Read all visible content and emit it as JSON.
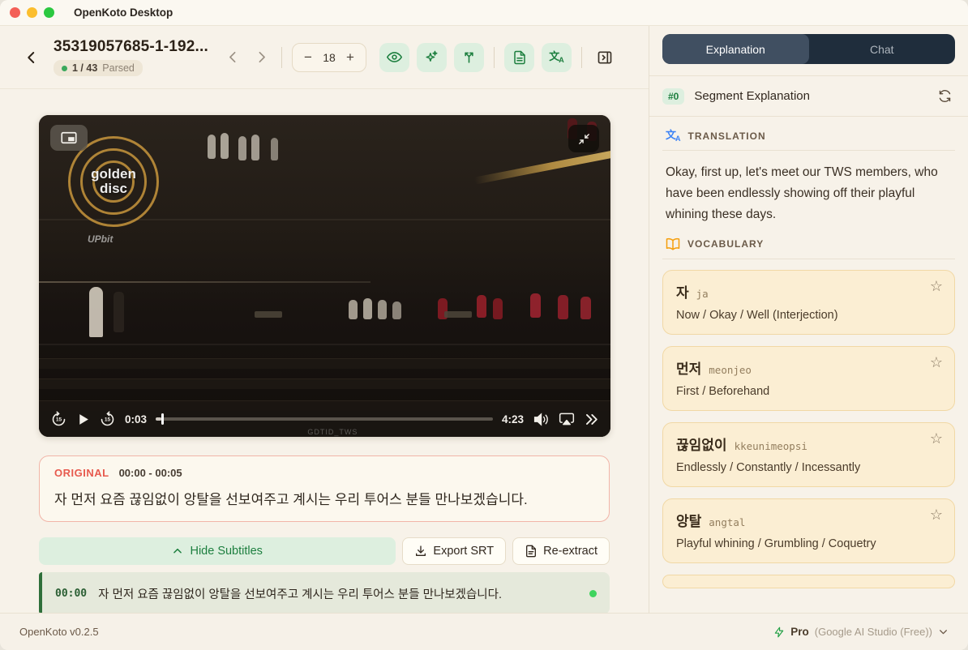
{
  "window": {
    "title": "OpenKoto Desktop"
  },
  "toolbar": {
    "video_title": "35319057685-1-192...",
    "badge_count": "1 / 43",
    "badge_status": "Parsed",
    "font_size": "18"
  },
  "player": {
    "current_time": "0:03",
    "duration": "4:23",
    "logo_text": "golden disc",
    "sponsor": "UPbit",
    "watermark": "GDTID_TWS"
  },
  "original": {
    "label": "ORIGINAL",
    "time_range": "00:00 - 00:05",
    "text": "자 먼저 요즘 끊임없이 앙탈을 선보여주고 계시는 우리 투어스 분들 만나보겠습니다."
  },
  "actions": {
    "hide_subtitles": "Hide Subtitles",
    "export_srt": "Export SRT",
    "re_extract": "Re-extract"
  },
  "subtitles": [
    {
      "time": "00:00",
      "text": "자 먼저 요즘 끊임없이 앙탈을 선보여주고 계시는 우리 투어스 분들 만나보겠습니다."
    }
  ],
  "right_panel": {
    "tabs": [
      {
        "label": "Explanation"
      },
      {
        "label": "Chat"
      }
    ],
    "segment_badge": "#0",
    "segment_title": "Segment Explanation",
    "translation_header": "TRANSLATION",
    "translation_text": "Okay, first up, let's meet our TWS members, who have been endlessly showing off their playful whining these days.",
    "vocabulary_header": "VOCABULARY",
    "vocabulary": [
      {
        "word": "자",
        "roman": "ja",
        "definition": "Now / Okay / Well (Interjection)"
      },
      {
        "word": "먼저",
        "roman": "meonjeo",
        "definition": "First / Beforehand"
      },
      {
        "word": "끊임없이",
        "roman": "kkeunimeopsi",
        "definition": "Endlessly / Constantly / Incessantly"
      },
      {
        "word": "앙탈",
        "roman": "angtal",
        "definition": "Playful whining / Grumbling / Coquetry"
      }
    ]
  },
  "footer": {
    "version": "OpenKoto v0.2.5",
    "plan": "Pro",
    "provider": "(Google AI Studio (Free))"
  },
  "icons": {
    "star": "☆",
    "minus": "−",
    "plus": "+",
    "translate_cjk": "文",
    "translate_lat": "A"
  },
  "colors": {
    "accent_green": "#1d7f3f",
    "mint": "#ddefdf",
    "navy_tab": "#1f2d3c",
    "navy_tab_active": "#404f61",
    "card_bg": "#fbeed3",
    "card_border": "#f1d8a5",
    "original_border": "#f1b5a8",
    "original_label": "#e75a4e",
    "background": "#f7f2e9"
  }
}
